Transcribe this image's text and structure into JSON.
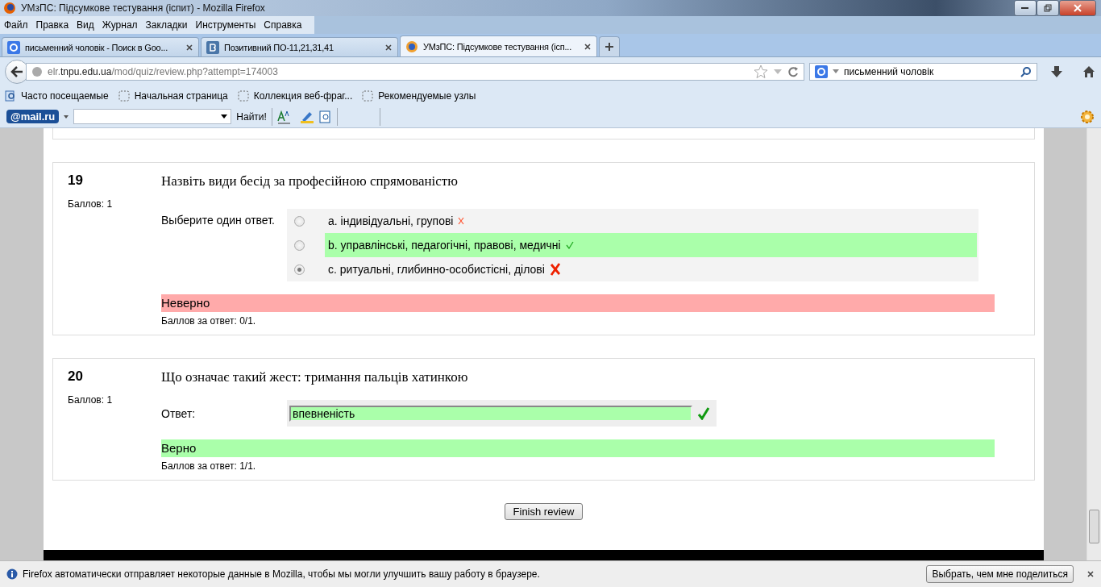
{
  "window": {
    "title": "УМзПС: Підсумкове тестування (іспит) - Mozilla Firefox"
  },
  "menu": [
    "Файл",
    "Правка",
    "Вид",
    "Журнал",
    "Закладки",
    "Инструменты",
    "Справка"
  ],
  "tabs": [
    {
      "label": "письменний чоловік - Поиск в Goo...",
      "kind": "google",
      "selected": false
    },
    {
      "label": "Позитивний ПО-11,21,31,41",
      "kind": "vk",
      "selected": false
    },
    {
      "label": "УМзПС: Підсумкове тестування (ісп...",
      "kind": "moodle",
      "selected": true
    }
  ],
  "address": "elr.**tnpu.edu.ua**/mod/quiz/review.php?attempt=174003",
  "search": {
    "value": "письменний чоловік"
  },
  "bookmarks": [
    {
      "label": "Часто посещаемые",
      "kind": "magnifier"
    },
    {
      "label": "Начальная страница",
      "kind": "page"
    },
    {
      "label": "Коллекция веб-фраг...",
      "kind": "page"
    },
    {
      "label": "Рекомендуемые узлы",
      "kind": "page"
    }
  ],
  "mailbar": {
    "logo": "@mail.ru",
    "find": "Найти!"
  },
  "questions": [
    {
      "number": "19",
      "grade": "Баллов: 1",
      "text": "Назвіть види бесід за професійною спрямованістю",
      "kind": "choice",
      "prompt": "Выберите один ответ.",
      "options": [
        {
          "label": "a. індивідуальні, групові",
          "selected": false,
          "correct": false,
          "kind": "small-cross"
        },
        {
          "label": "b. управлінські, педагогічні, правові, медичні",
          "selected": false,
          "correct": true,
          "kind": "small-tick"
        },
        {
          "label": "c. ритуальні, глибинно-особистісні, ділові",
          "selected": true,
          "correct": false,
          "kind": "cross"
        }
      ],
      "feedback": {
        "text": "Неверно",
        "correct": false
      },
      "score": "Баллов за ответ: 0/1."
    },
    {
      "number": "20",
      "grade": "Баллов: 1",
      "text": "Що означає такий жест: тримання пальців хатинкою",
      "kind": "text",
      "prompt": "Ответ:",
      "answer": "впевненість",
      "result": {
        "kind": "tick"
      },
      "feedback": {
        "text": "Верно",
        "correct": true
      },
      "score": "Баллов за ответ: 1/1."
    }
  ],
  "finish_button": "Finish review",
  "notification": {
    "text": "Firefox автоматически отправляет некоторые данные в Mozilla, чтобы мы могли улучшить вашу работу в браузере.",
    "button": "Выбрать, чем мне поделиться"
  }
}
